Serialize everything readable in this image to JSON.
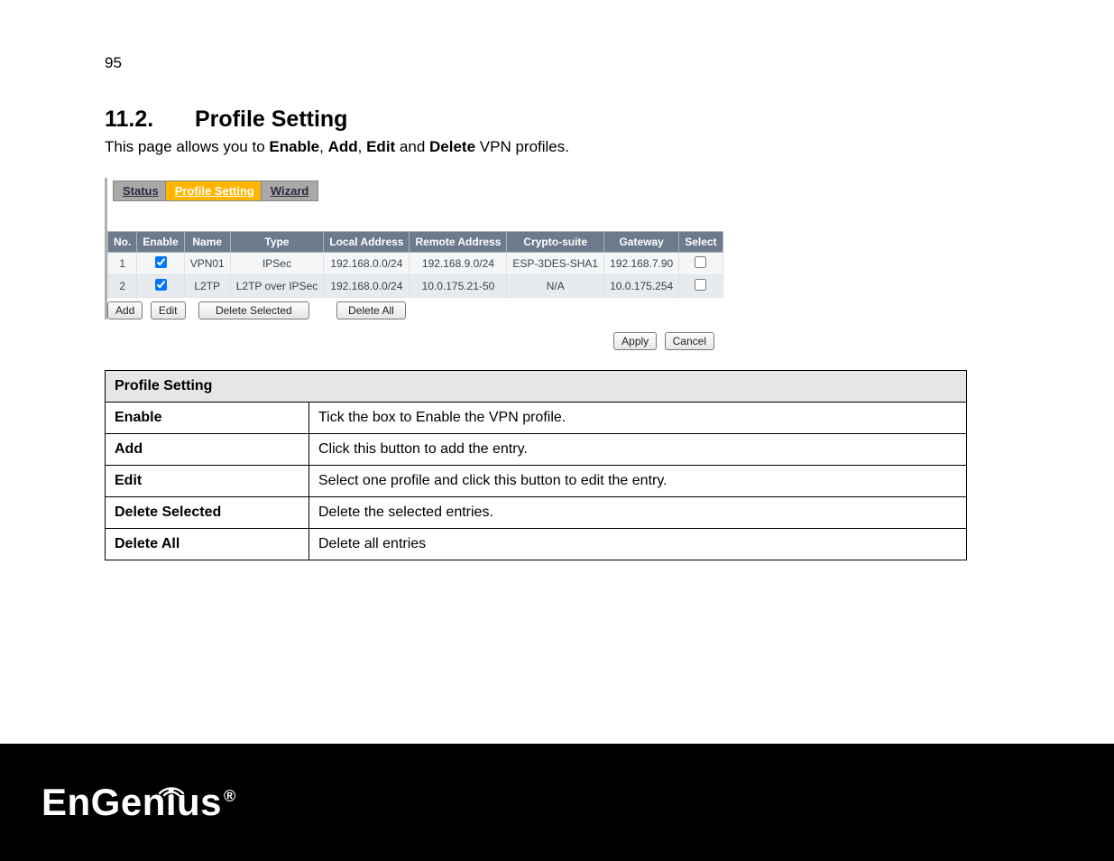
{
  "page_number": "95",
  "heading_number": "11.2.",
  "heading_title": "Profile Setting",
  "intro_parts": {
    "p1": "This page allows you to ",
    "b1": "Enable",
    "s1": ", ",
    "b2": "Add",
    "s2": ", ",
    "b3": "Edit",
    "s3": " and ",
    "b4": "Delete",
    "p2": " VPN profiles."
  },
  "tabs": {
    "t0": "Status",
    "t1": "Profile Setting",
    "t2": "Wizard",
    "active_index": 1
  },
  "grid": {
    "headers": {
      "h0": "No.",
      "h1": "Enable",
      "h2": "Name",
      "h3": "Type",
      "h4": "Local Address",
      "h5": "Remote Address",
      "h6": "Crypto-suite",
      "h7": "Gateway",
      "h8": "Select"
    },
    "rows": [
      {
        "no": "1",
        "enable": true,
        "name": "VPN01",
        "type": "IPSec",
        "local": "192.168.0.0/24",
        "remote": "192.168.9.0/24",
        "crypto": "ESP-3DES-SHA1",
        "gateway": "192.168.7.90",
        "select": false
      },
      {
        "no": "2",
        "enable": true,
        "name": "L2TP",
        "type": "L2TP over IPSec",
        "local": "192.168.0.0/24",
        "remote": "10.0.175.21-50",
        "crypto": "N/A",
        "gateway": "10.0.175.254",
        "select": false
      }
    ]
  },
  "buttons": {
    "add": "Add",
    "edit": "Edit",
    "delete_selected": "Delete Selected",
    "delete_all": "Delete All",
    "apply": "Apply",
    "cancel": "Cancel"
  },
  "desc": {
    "title": "Profile Setting",
    "rows": {
      "enable_k": "Enable",
      "enable_v": "Tick the box to Enable the VPN profile.",
      "add_k": "Add",
      "add_v": "Click this button to add the entry.",
      "edit_k": "Edit",
      "edit_v": "Select one profile and click this button to edit the entry.",
      "delsel_k": "Delete Selected",
      "delsel_v": "Delete the selected entries.",
      "delall_k": "Delete All",
      "delall_v": "Delete all entries"
    }
  },
  "brand": {
    "part1": "EnGen",
    "part2": "us",
    "reg": "®"
  }
}
